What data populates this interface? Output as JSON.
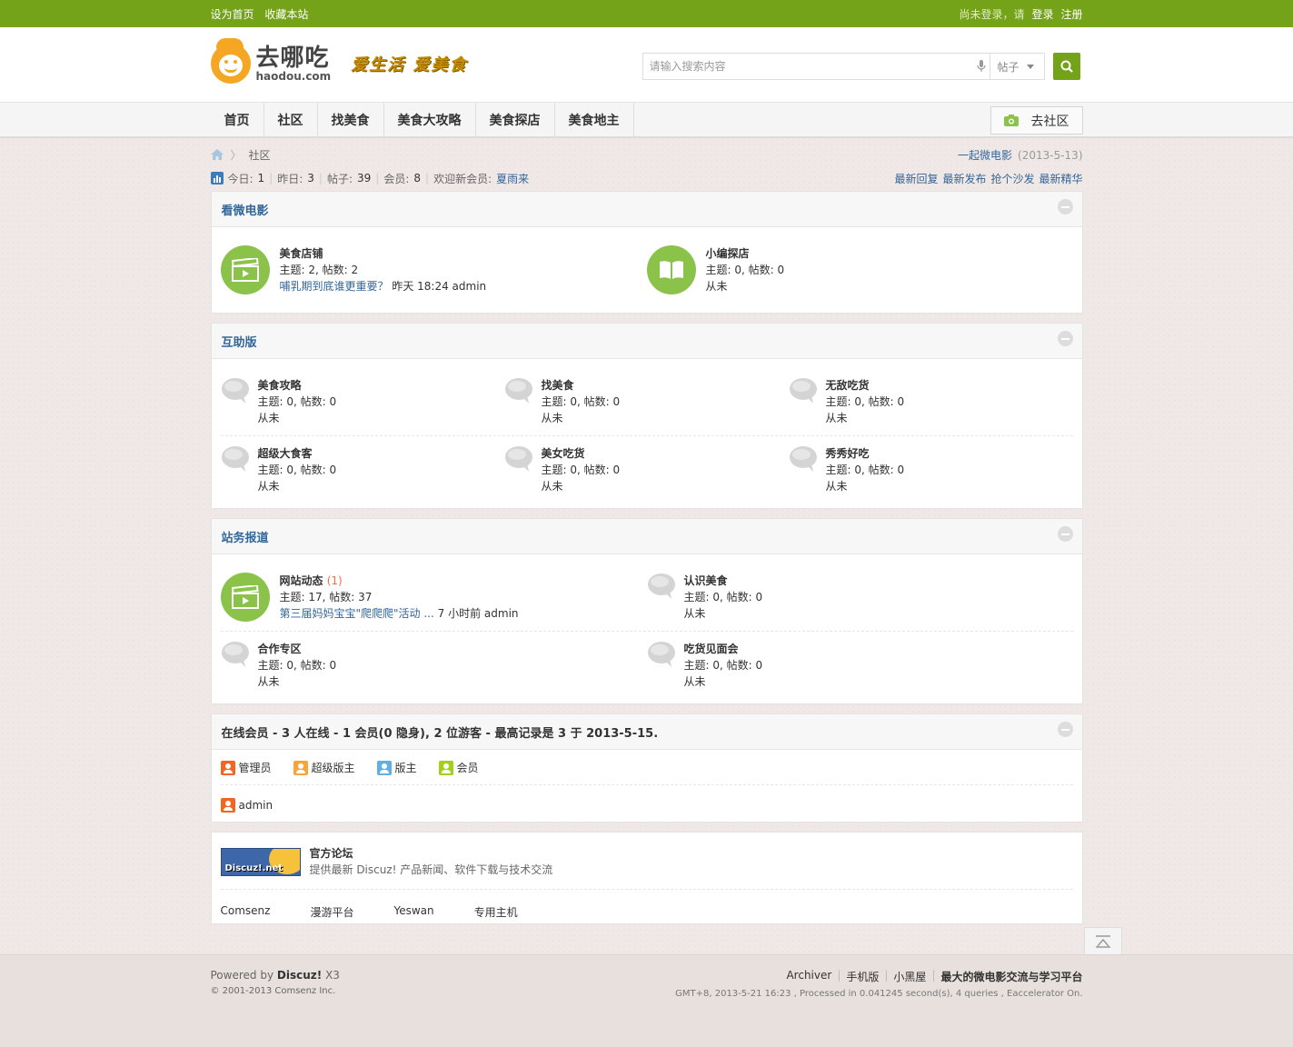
{
  "topbar": {
    "set_home": "设为首页",
    "bookmark": "收藏本站",
    "not_logged": "尚未登录，请",
    "login": "登录",
    "register": "注册"
  },
  "header": {
    "logo_cn": "去哪吃",
    "logo_en": "haodou.com",
    "slogan": "爱生活 爱美食",
    "search_placeholder": "请输入搜索内容",
    "search_type": "帖子"
  },
  "nav": {
    "items": [
      "首页",
      "社区",
      "找美食",
      "美食大攻略",
      "美食探店",
      "美食地主"
    ],
    "community_btn": "去社区"
  },
  "breadcrumb": {
    "current": "社区",
    "right_link": "一起微电影",
    "right_date": "(2013-5-13)"
  },
  "stats": {
    "today_label": "今日:",
    "today": "1",
    "yesterday_label": "昨日:",
    "yesterday": "3",
    "posts_label": "帖子:",
    "posts": "39",
    "members_label": "会员:",
    "members": "8",
    "welcome": "欢迎新会员:",
    "new_member": "夏雨来",
    "links": [
      "最新回复",
      "最新发布",
      "抢个沙发",
      "最新精华"
    ]
  },
  "section1": {
    "title": "看微电影",
    "forums": [
      {
        "name": "美食店铺",
        "meta": "主题: 2, 帖数: 2",
        "last_link": "哺乳期到底谁更重要？",
        "last_info": "昨天 18:24 admin"
      },
      {
        "name": "小编探店",
        "meta": "主题: 0, 帖数: 0",
        "last_info": "从未"
      }
    ]
  },
  "section2": {
    "title": "互助版",
    "forums": [
      {
        "name": "美食攻略",
        "meta": "主题: 0, 帖数: 0",
        "last_info": "从未"
      },
      {
        "name": "找美食",
        "meta": "主题: 0, 帖数: 0",
        "last_info": "从未"
      },
      {
        "name": "无敌吃货",
        "meta": "主题: 0, 帖数: 0",
        "last_info": "从未"
      },
      {
        "name": "超级大食客",
        "meta": "主题: 0, 帖数: 0",
        "last_info": "从未"
      },
      {
        "name": "美女吃货",
        "meta": "主题: 0, 帖数: 0",
        "last_info": "从未"
      },
      {
        "name": "秀秀好吃",
        "meta": "主题: 0, 帖数: 0",
        "last_info": "从未"
      }
    ]
  },
  "section3": {
    "title": "站务报道",
    "forums": [
      {
        "name": "网站动态",
        "today": "(1)",
        "meta": "主题: 17, 帖数: 37",
        "last_link": "第三届妈妈宝宝\"爬爬爬\"活动 ...",
        "last_info": "7 小时前 admin"
      },
      {
        "name": "认识美食",
        "meta": "主题: 0, 帖数: 0",
        "last_info": "从未"
      },
      {
        "name": "合作专区",
        "meta": "主题: 0, 帖数: 0",
        "last_info": "从未"
      },
      {
        "name": "吃货见面会",
        "meta": "主题: 0, 帖数: 0",
        "last_info": "从未"
      }
    ]
  },
  "online": {
    "title": "在线会员 - 3 人在线 - 1 会员(0 隐身), 2 位游客 - 最高记录是 3 于 2013-5-15.",
    "legend": [
      "管理员",
      "超级版主",
      "版主",
      "会员"
    ],
    "users": [
      "admin"
    ]
  },
  "links": {
    "logo_text": "Discuz!.net",
    "name": "官方论坛",
    "desc": "提供最新 Discuz! 产品新闻、软件下载与技术交流",
    "items": [
      "Comsenz",
      "漫游平台",
      "Yeswan",
      "专用主机"
    ]
  },
  "footer": {
    "powered": "Powered by",
    "product": "Discuz!",
    "version": "X3",
    "copyright": "© 2001-2013 Comsenz Inc.",
    "links": [
      "Archiver",
      "手机版",
      "小黑屋"
    ],
    "tagline": "最大的微电影交流与学习平台",
    "debug": "GMT+8, 2013-5-21 16:23 , Processed in 0.041245 second(s), 4 queries , Eaccelerator On."
  },
  "colors": {
    "brand_green": "#74a219",
    "link_blue": "#336699",
    "forum_icon_green": "#8bc34a",
    "admin_orange": "#f26522",
    "supermod_orange": "#f7a53b",
    "mod_blue": "#5fb0e4",
    "member_green": "#a3d11b"
  }
}
